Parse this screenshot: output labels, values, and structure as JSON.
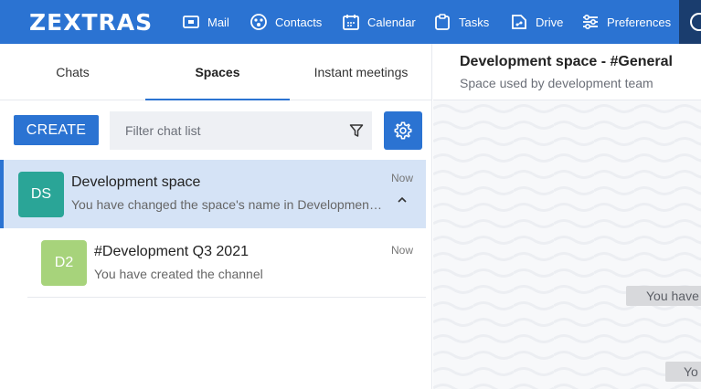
{
  "app": {
    "logo": "ZEXTRAS"
  },
  "nav": [
    {
      "label": "Mail",
      "icon": "mail-icon"
    },
    {
      "label": "Contacts",
      "icon": "contacts-icon"
    },
    {
      "label": "Calendar",
      "icon": "calendar-icon"
    },
    {
      "label": "Tasks",
      "icon": "tasks-icon"
    },
    {
      "label": "Drive",
      "icon": "drive-icon"
    },
    {
      "label": "Preferences",
      "icon": "preferences-icon"
    }
  ],
  "tabs": [
    {
      "label": "Chats",
      "active": false
    },
    {
      "label": "Spaces",
      "active": true
    },
    {
      "label": "Instant meetings",
      "active": false
    }
  ],
  "toolbar": {
    "create_label": "CREATE",
    "filter_placeholder": "Filter chat list"
  },
  "chat_list": [
    {
      "avatar": "DS",
      "avatar_color": "#2aa597",
      "title": "Development space",
      "subtitle": "You have changed the space's name in Development space",
      "time": "Now",
      "expanded": true
    },
    {
      "avatar": "D2",
      "avatar_color": "#a7d37b",
      "title": "#Development Q3 2021",
      "subtitle": "You have created the channel",
      "time": "Now"
    }
  ],
  "conversation": {
    "title": "Development space - #General",
    "subtitle": "Space used by development team",
    "bubbles": [
      "You have",
      "Yo"
    ]
  },
  "colors": {
    "accent": "#2b73d2",
    "selected_row": "#d5e3f6"
  }
}
